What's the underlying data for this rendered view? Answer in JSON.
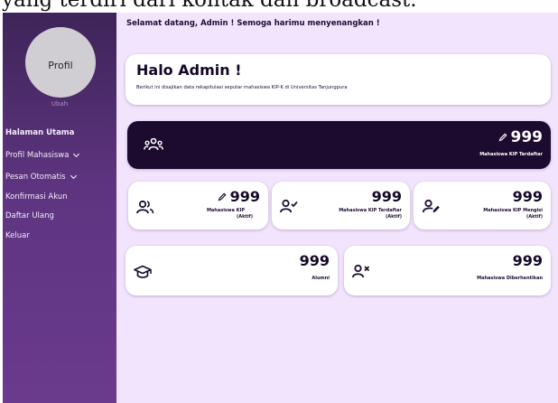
{
  "header_partial_text": "yang terdiri dari kontak dan broadcast.",
  "sidebar": {
    "avatar_label": "Profil",
    "avatar_change": "Ubah",
    "items": [
      {
        "label": "Halaman Utama"
      },
      {
        "label": "Profil Mahasiswa"
      },
      {
        "label": "Pesan Otomatis"
      },
      {
        "label": "Konfirmasi Akun"
      },
      {
        "label": "Daftar Ulang"
      },
      {
        "label": "Keluar"
      }
    ]
  },
  "main": {
    "greeting": "Selamat datang, Admin ! Semoga harimu menyenangkan !",
    "hello_title": "Halo Admin !",
    "hello_subtitle": "Berikut ini disajikan data rekapitulasi seputar mahasiswa KIP-K di Universitas Tanjungpura",
    "stats": {
      "registered": {
        "value": "999",
        "label": "Mahasiswa KIP Terdaftar"
      },
      "active": {
        "value": "999",
        "label_1": "Mahasiswa KIP",
        "label_2": "(Aktif)"
      },
      "registered_active": {
        "value": "999",
        "label_1": "Mahasiswa KIP Terdaftar",
        "label_2": "(Aktif)"
      },
      "filling_active": {
        "value": "999",
        "label_1": "Mahasiswa KIP Mengisi",
        "label_2": "(Aktif)"
      },
      "alumni": {
        "value": "999",
        "label": "Alumni"
      },
      "dismissed": {
        "value": "999",
        "label": "Mahasiswa Diberhentikan"
      }
    }
  },
  "icons": {
    "group": "users-group-icon",
    "edit": "pencil-icon",
    "user_check": "user-check-icon",
    "user_edit": "user-edit-icon",
    "graduation": "graduation-cap-icon",
    "user_remove": "user-x-icon"
  },
  "colors": {
    "sidebar_top": "#3e2459",
    "sidebar_bottom": "#6b3a8e",
    "main_bg": "#f2e4fd",
    "dark_card": "#1c0a2f",
    "text_dark": "#1e0e33"
  }
}
